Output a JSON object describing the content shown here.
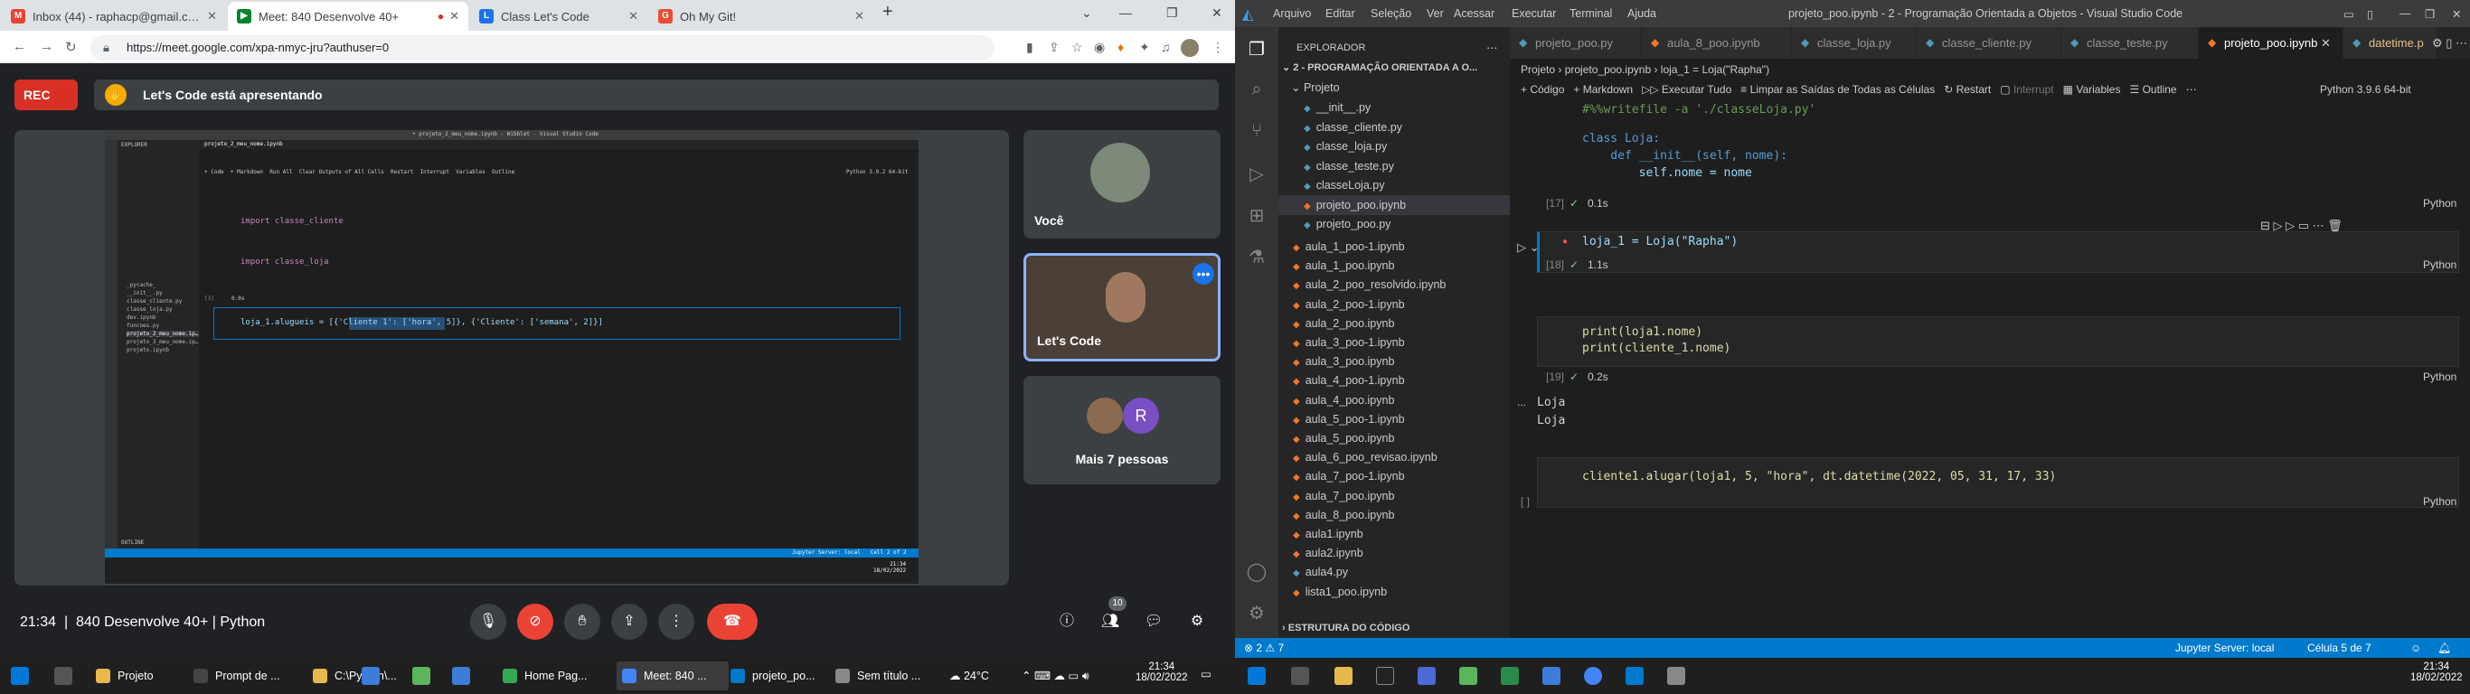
{
  "left_screen": {
    "browser": {
      "tabs": [
        {
          "label": "Inbox (44) - raphacp@gmail.com",
          "icon": "gmail-icon",
          "color": "#ea4335"
        },
        {
          "label": "Meet: 840 Desenvolve 40+",
          "icon": "meet-icon",
          "color": "#00832d"
        },
        {
          "label": "Class Let's Code",
          "icon": "letscode-icon",
          "color": "#1a73e8"
        },
        {
          "label": "Oh My Git!",
          "icon": "git-icon",
          "color": "#e94e31"
        }
      ],
      "new_tab": "+",
      "url": "https://meet.google.com/xpa-nmyc-jru?authuser=0"
    },
    "meet": {
      "rec_label": "REC",
      "presenting_text": "Let's Code está apresentando",
      "tiles": [
        {
          "name": "Você"
        },
        {
          "name": "Let's Code"
        },
        {
          "name": "Mais 7 pessoas",
          "avatar_letter": "R"
        }
      ],
      "time": "21:34",
      "meeting_name": "840 Desenvolve 40+ | Python",
      "participants_count": "10"
    },
    "shared_screen": {
      "title": "• projeto_2_meu_nome.ipynb - Wibblet - Visual Studio Code",
      "explorer_title": "EXPLORER",
      "files": [
        "_pycache_",
        "__init__.py",
        "classe_cliente.py",
        "classe_loja.py",
        "dev.ipynb",
        "funcoes.py",
        "projeto_2_meu_nome.ipynb",
        "projeto_3_meu_nome.ipynb",
        "projeto.ipynb"
      ],
      "tab": "projeto_2_meu_nome.ipynb",
      "toolbar": [
        "+ Code",
        "+ Markdown",
        "Run All",
        "Clear Outputs of All Cells",
        "Restart",
        "Interrupt",
        "Variables",
        "Outline"
      ],
      "kernel": "Python 3.9.2 64-bit",
      "code_lines": [
        "import classe_cliente",
        "import classe_loja"
      ],
      "cell_counter": "[3]",
      "cell_time": "0.0s",
      "line2": "loja_1.alugueis = [{'Cliente 1': ['hora', 5]}, {'Cliente': ['semana', 2]}]",
      "outline": "OUTLINE",
      "status_text": "Jupyter Server: local",
      "status_cell": "Cell 2 of 2",
      "clock": "21:34",
      "date": "18/02/2022"
    }
  },
  "right_screen": {
    "vscode": {
      "menu": [
        "Arquivo",
        "Editar",
        "Seleção",
        "Ver",
        "Acessar",
        "Executar",
        "Terminal",
        "Ajuda"
      ],
      "title": "projeto_poo.ipynb - 2 - Programação Orientada a Objetos - Visual Studio Code",
      "explorer_label": "EXPLORADOR",
      "workspace": "2 - PROGRAMAÇÃO ORIENTADA A O...",
      "folder": "Projeto",
      "project_files": [
        "__init__.py",
        "classe_cliente.py",
        "classe_loja.py",
        "classe_teste.py",
        "classeLoja.py",
        "projeto_poo.ipynb",
        "projeto_poo.py"
      ],
      "root_files": [
        "aula_1_poo-1.ipynb",
        "aula_1_poo.ipynb",
        "aula_2_poo_resolvido.ipynb",
        "aula_2_poo-1.ipynb",
        "aula_2_poo.ipynb",
        "aula_3_poo-1.ipynb",
        "aula_3_poo.ipynb",
        "aula_4_poo-1.ipynb",
        "aula_4_poo.ipynb",
        "aula_5_poo-1.ipynb",
        "aula_5_poo.ipynb",
        "aula_6_poo_revisao.ipynb",
        "aula_7_poo-1.ipynb",
        "aula_7_poo.ipynb",
        "aula_8_poo.ipynb",
        "aula1.ipynb",
        "aula2.ipynb",
        "aula4.py",
        "lista1_poo.ipynb"
      ],
      "outline_label": "ESTRUTURA DO CÓDIGO",
      "tabs": [
        "projeto_poo.py",
        "aula_8_poo.ipynb",
        "classe_loja.py",
        "classe_cliente.py",
        "classe_teste.py",
        "projeto_poo.ipynb",
        "datetime.p"
      ],
      "breadcrumb": [
        "Projeto",
        "projeto_poo.ipynb",
        "loja_1 = Loja(\"Rapha\")"
      ],
      "toolbar": [
        "+ Código",
        "+ Markdown",
        "Executar Tudo",
        "Limpar as Saídas de Todas as Células",
        "Restart",
        "Interrupt",
        "Variables",
        "Outline",
        "Python 3.9.6 64-bit"
      ],
      "cells": {
        "c17": {
          "lines": [
            "#%%writefile -a './classeLoja.py'",
            "",
            "class Loja:",
            "    def __init__(self, nome):",
            "        self.nome = nome"
          ],
          "counter": "[17]",
          "time": "0.1s",
          "lang": "Python"
        },
        "c18": {
          "lines": [
            "loja_1 = Loja(\"Rapha\")"
          ],
          "counter": "[18]",
          "time": "1.1s",
          "lang": "Python"
        },
        "c19": {
          "lines": [
            "print(loja1.nome)",
            "print(cliente_1.nome)"
          ],
          "counter": "[19]",
          "time": "0.2s",
          "lang": "Python",
          "output": [
            "Loja",
            "Loja"
          ],
          "output_dots": "..."
        },
        "c20": {
          "lines": [
            "cliente1.alugar(loja1, 5, \"hora\", dt.datetime(2022, 05, 31, 17, 33)"
          ],
          "counter": "[ ]",
          "lang": "Python"
        }
      },
      "status": {
        "problems": "⊗ 2 ⚠ 7",
        "jupyter": "Jupyter Server: local",
        "cell": "Célula 5 de 7"
      }
    }
  },
  "taskbar_left": {
    "items": [
      {
        "label": "Projeto",
        "color": "#e8b84a"
      },
      {
        "label": "Prompt de ...",
        "color": "#444"
      },
      {
        "label": "C:\\Python\\...",
        "color": "#e8b84a"
      },
      {
        "label": "Home Pag...",
        "color": "#34a853"
      },
      {
        "label": "Meet: 840 ...",
        "color": "#4285f4"
      },
      {
        "label": "projeto_po...",
        "color": "#007acc"
      },
      {
        "label": "Sem título ...",
        "color": "#888"
      }
    ],
    "weather": "24°C",
    "time": "21:34",
    "date": "18/02/2022"
  },
  "taskbar_right": {
    "time": "21:34",
    "date": "18/02/2022"
  }
}
